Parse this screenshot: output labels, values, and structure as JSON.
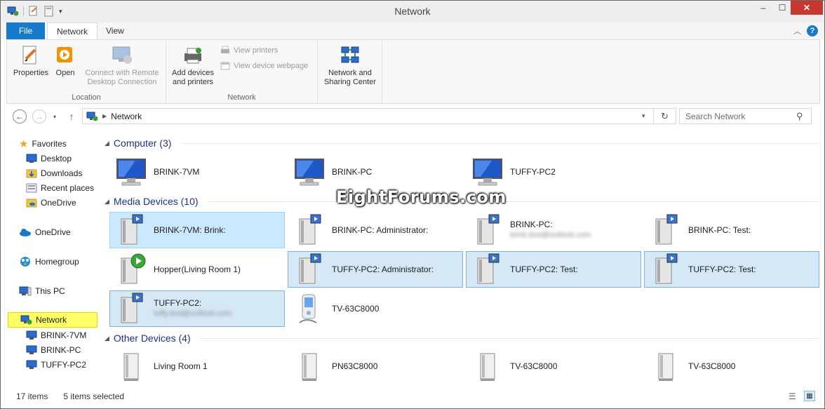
{
  "window": {
    "title": "Network",
    "minimize": "–",
    "maximize": "☐",
    "close": "✕"
  },
  "ribbon": {
    "tabs": [
      {
        "label": "File"
      },
      {
        "label": "Network"
      },
      {
        "label": "View"
      }
    ],
    "groups": [
      {
        "label": "Location",
        "buttons": [
          "Properties",
          "Open",
          "Connect with Remote",
          "Desktop Connection"
        ]
      },
      {
        "label": "Network",
        "buttons": [
          "Add devices",
          "and printers",
          "View printers",
          "View device webpage"
        ]
      },
      {
        "buttons": [
          "Network and",
          "Sharing Center"
        ]
      }
    ]
  },
  "address": {
    "path": "Network",
    "search_placeholder": "Search Network"
  },
  "nav": {
    "favorites": "Favorites",
    "items": [
      "Desktop",
      "Downloads",
      "Recent places",
      "OneDrive"
    ],
    "onedrive": "OneDrive",
    "homegroup": "Homegroup",
    "thispc": "This PC",
    "network": "Network",
    "network_children": [
      "BRINK-7VM",
      "BRINK-PC",
      "TUFFY-PC2"
    ]
  },
  "groups": {
    "computer": {
      "title": "Computer (3)",
      "items": [
        "BRINK-7VM",
        "BRINK-PC",
        "TUFFY-PC2"
      ]
    },
    "media": {
      "title": "Media Devices (10)",
      "items": [
        {
          "label": "BRINK-7VM: Brink:",
          "sub": ""
        },
        {
          "label": "BRINK-PC: Administrator:",
          "sub": ""
        },
        {
          "label": "BRINK-PC:",
          "sub": "brink.test@outlook.com"
        },
        {
          "label": "BRINK-PC: Test:",
          "sub": ""
        },
        {
          "label": "Hopper(Living Room 1)",
          "sub": ""
        },
        {
          "label": "TUFFY-PC2: Administrator:",
          "sub": ""
        },
        {
          "label": "TUFFY-PC2: Test:",
          "sub": ""
        },
        {
          "label": "TUFFY-PC2: Test:",
          "sub": ""
        },
        {
          "label": "TUFFY-PC2:",
          "sub": "tuffy.test@outlook.com"
        },
        {
          "label": "TV-63C8000",
          "sub": ""
        }
      ]
    },
    "other": {
      "title": "Other Devices (4)",
      "items": [
        "Living Room 1",
        "PN63C8000",
        "TV-63C8000",
        "TV-63C8000"
      ]
    }
  },
  "status": {
    "items": "17 items",
    "selected": "5 items selected"
  },
  "watermark": "EightForums.com",
  "colors": {
    "accent": "#1979ca",
    "selection": "#cce8ff",
    "nav_highlight": "#ffff66",
    "group_header": "#1e3287"
  }
}
